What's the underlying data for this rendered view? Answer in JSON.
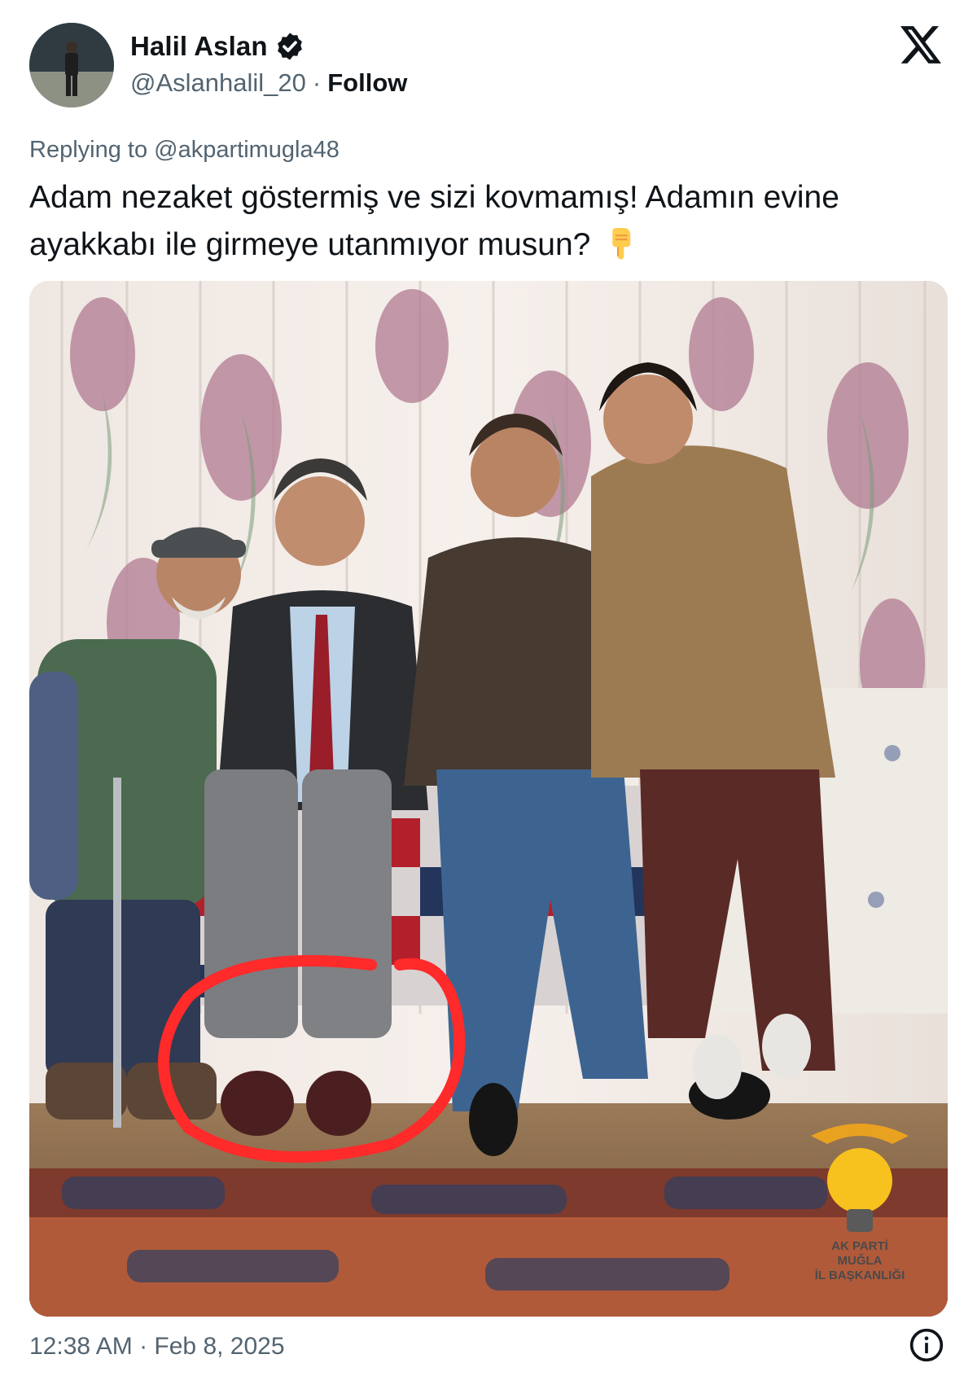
{
  "author": {
    "display_name": "Halil Aslan",
    "handle": "@Aslanhalil_20",
    "separator": "·",
    "follow_label": "Follow",
    "verified": true
  },
  "platform_icon": "x-logo-icon",
  "reply": {
    "prefix": "Replying to",
    "mention": "@akpartimugla48"
  },
  "tweet": {
    "text_line1": "Adam nezaket göstermiş ve sizi kovmamış! Adamın evine",
    "text_line2": "ayakkabı ile girmeye utanmıyor musun?",
    "emoji": "backhand-index-pointing-down-icon"
  },
  "photo": {
    "logo_text_line1": "AK PARTİ",
    "logo_text_line2": "MUĞLA",
    "logo_text_line3": "İL BAŞKANLIĞI",
    "annotation": "red-circle-around-shoes"
  },
  "footer": {
    "timestamp": "12:38 AM · Feb 8, 2025",
    "info_icon": "info-icon"
  },
  "colors": {
    "text_primary": "#0f1419",
    "text_secondary": "#536471",
    "verified_badge": "#0f1419",
    "annotation_red": "#ff2a2a"
  }
}
